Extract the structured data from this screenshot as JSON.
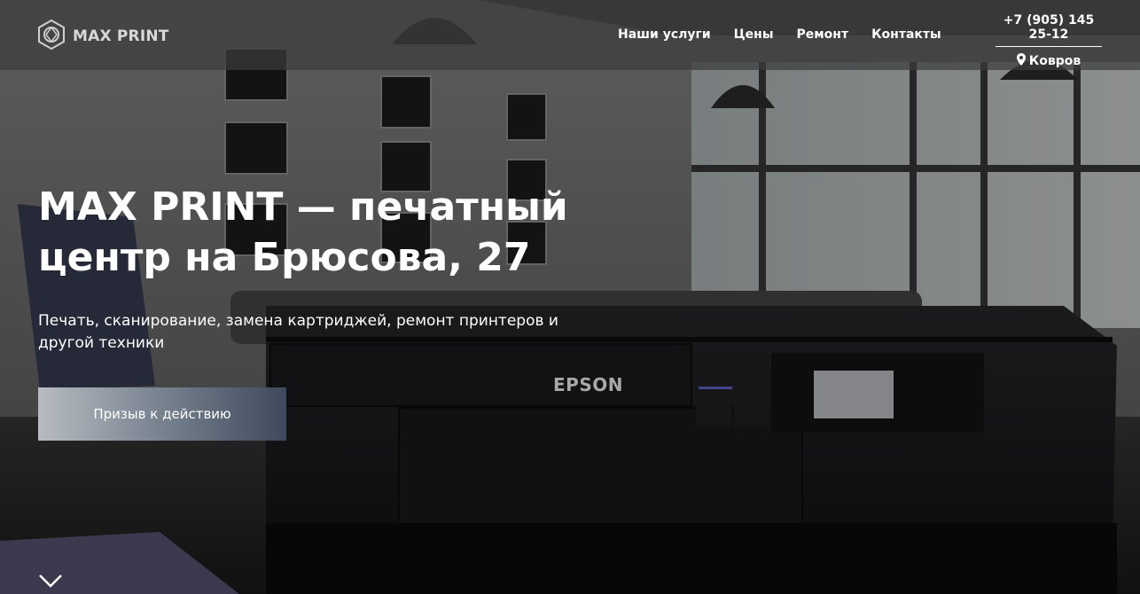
{
  "brand": {
    "name": "MAX PRINT"
  },
  "nav": [
    {
      "label": "Наши услуги"
    },
    {
      "label": "Цены"
    },
    {
      "label": "Ремонт"
    },
    {
      "label": "Контакты"
    }
  ],
  "contact": {
    "phone": "+7 (905) 145 25-12",
    "city": "Ковров"
  },
  "hero": {
    "title": "MAX PRINT — печатный центр на Брюсова, 27",
    "subtitle": "Печать, сканирование, замена картриджей, ремонт принтеров и другой техники",
    "cta_label": "Призыв к действию"
  },
  "printer": {
    "brand_label": "EPSON"
  },
  "colors": {
    "header_bg": "#3c3c3c",
    "text": "#ffffff",
    "cta_start": "#b7bcc1",
    "cta_end": "#3d4a5b"
  },
  "icons": {
    "logo": "hexagon-aperture-icon",
    "location": "map-pin-icon",
    "scroll": "chevron-down-icon"
  }
}
